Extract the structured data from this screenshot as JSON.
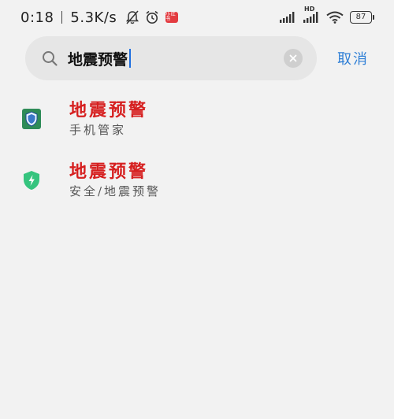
{
  "status_bar": {
    "time": "0:18",
    "network_speed": "5.3K/s",
    "hd_label": "HD",
    "battery_level": "87",
    "app_badge_text": "小红书",
    "icons": [
      "bell-off-icon",
      "alarm-clock-icon",
      "app-badge-icon",
      "signal-icon",
      "signal-hd-icon",
      "wifi-icon",
      "battery-icon"
    ]
  },
  "search": {
    "query": "地震预警",
    "cancel_label": "取消",
    "icon": "search-icon",
    "clear_icon": "clear-icon"
  },
  "results": [
    {
      "title": "地震预警",
      "subtitle": "手机管家",
      "icon": "phone-manager-shield-icon",
      "icon_color": "#2e8b57"
    },
    {
      "title": "地震预警",
      "subtitle": "安全/地震预警",
      "icon": "security-bolt-shield-icon",
      "icon_color": "#35c47e"
    }
  ],
  "colors": {
    "background": "#f2f2f2",
    "search_box": "#e6e6e6",
    "accent": "#2f7fd6",
    "highlight_title": "#d62020"
  }
}
